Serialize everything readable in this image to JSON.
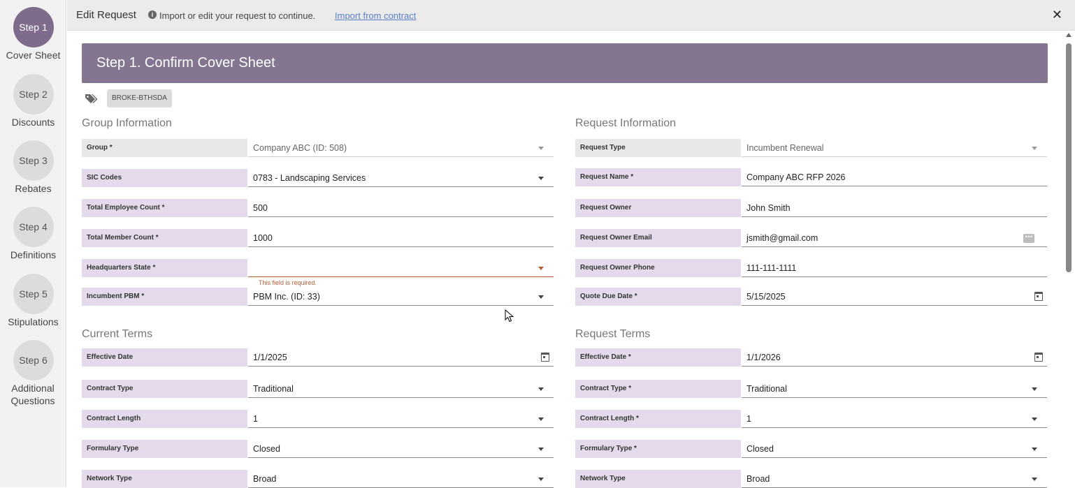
{
  "stepper": [
    {
      "circle": "Step 1",
      "label": "Cover Sheet",
      "active": true
    },
    {
      "circle": "Step 2",
      "label": "Discounts",
      "active": false
    },
    {
      "circle": "Step 3",
      "label": "Rebates",
      "active": false
    },
    {
      "circle": "Step 4",
      "label": "Definitions",
      "active": false
    },
    {
      "circle": "Step 5",
      "label": "Stipulations",
      "active": false
    },
    {
      "circle": "Step 6",
      "label": "Additional Questions",
      "active": false
    }
  ],
  "topbar": {
    "title": "Edit Request",
    "hint": "Import or edit your request to continue.",
    "link": "Import from contract",
    "close": "✕"
  },
  "banner": {
    "title": "Step 1. Confirm Cover Sheet"
  },
  "tag": {
    "label": "BROKE-BTHSDA"
  },
  "group_info": {
    "title": "Group Information",
    "rows": [
      {
        "label": "Group *",
        "value": "Company ABC (ID: 508)"
      },
      {
        "label": "SIC Codes",
        "value": "0783 - Landscaping Services"
      },
      {
        "label": "Total Employee Count *",
        "value": "500"
      },
      {
        "label": "Total Member Count *",
        "value": "1000"
      },
      {
        "label": "Headquarters State *",
        "value": ""
      },
      {
        "label": "Incumbent PBM *",
        "value": "PBM Inc. (ID: 33)"
      }
    ],
    "error": "This field is required."
  },
  "request_info": {
    "title": "Request Information",
    "rows": [
      {
        "label": "Request Type",
        "value": "Incumbent Renewal"
      },
      {
        "label": "Request Name *",
        "value": "Company ABC RFP 2026"
      },
      {
        "label": "Request Owner",
        "value": "John Smith"
      },
      {
        "label": "Request Owner Email",
        "value": "jsmith@gmail.com"
      },
      {
        "label": "Request Owner Phone",
        "value": "111-111-1111"
      },
      {
        "label": "Quote Due Date *",
        "value": "5/15/2025"
      }
    ]
  },
  "current_terms": {
    "title": "Current Terms",
    "rows": [
      {
        "label": "Effective Date",
        "value": "1/1/2025"
      },
      {
        "label": "Contract Type",
        "value": "Traditional"
      },
      {
        "label": "Contract Length",
        "value": "1"
      },
      {
        "label": "Formulary Type",
        "value": "Closed"
      },
      {
        "label": "Network Type",
        "value": "Broad"
      }
    ]
  },
  "request_terms": {
    "title": "Request Terms",
    "rows": [
      {
        "label": "Effective Date *",
        "value": "1/1/2026"
      },
      {
        "label": "Contract Type *",
        "value": "Traditional"
      },
      {
        "label": "Contract Length *",
        "value": "1"
      },
      {
        "label": "Formulary Type *",
        "value": "Closed"
      },
      {
        "label": "Network Type",
        "value": "Broad"
      }
    ]
  }
}
